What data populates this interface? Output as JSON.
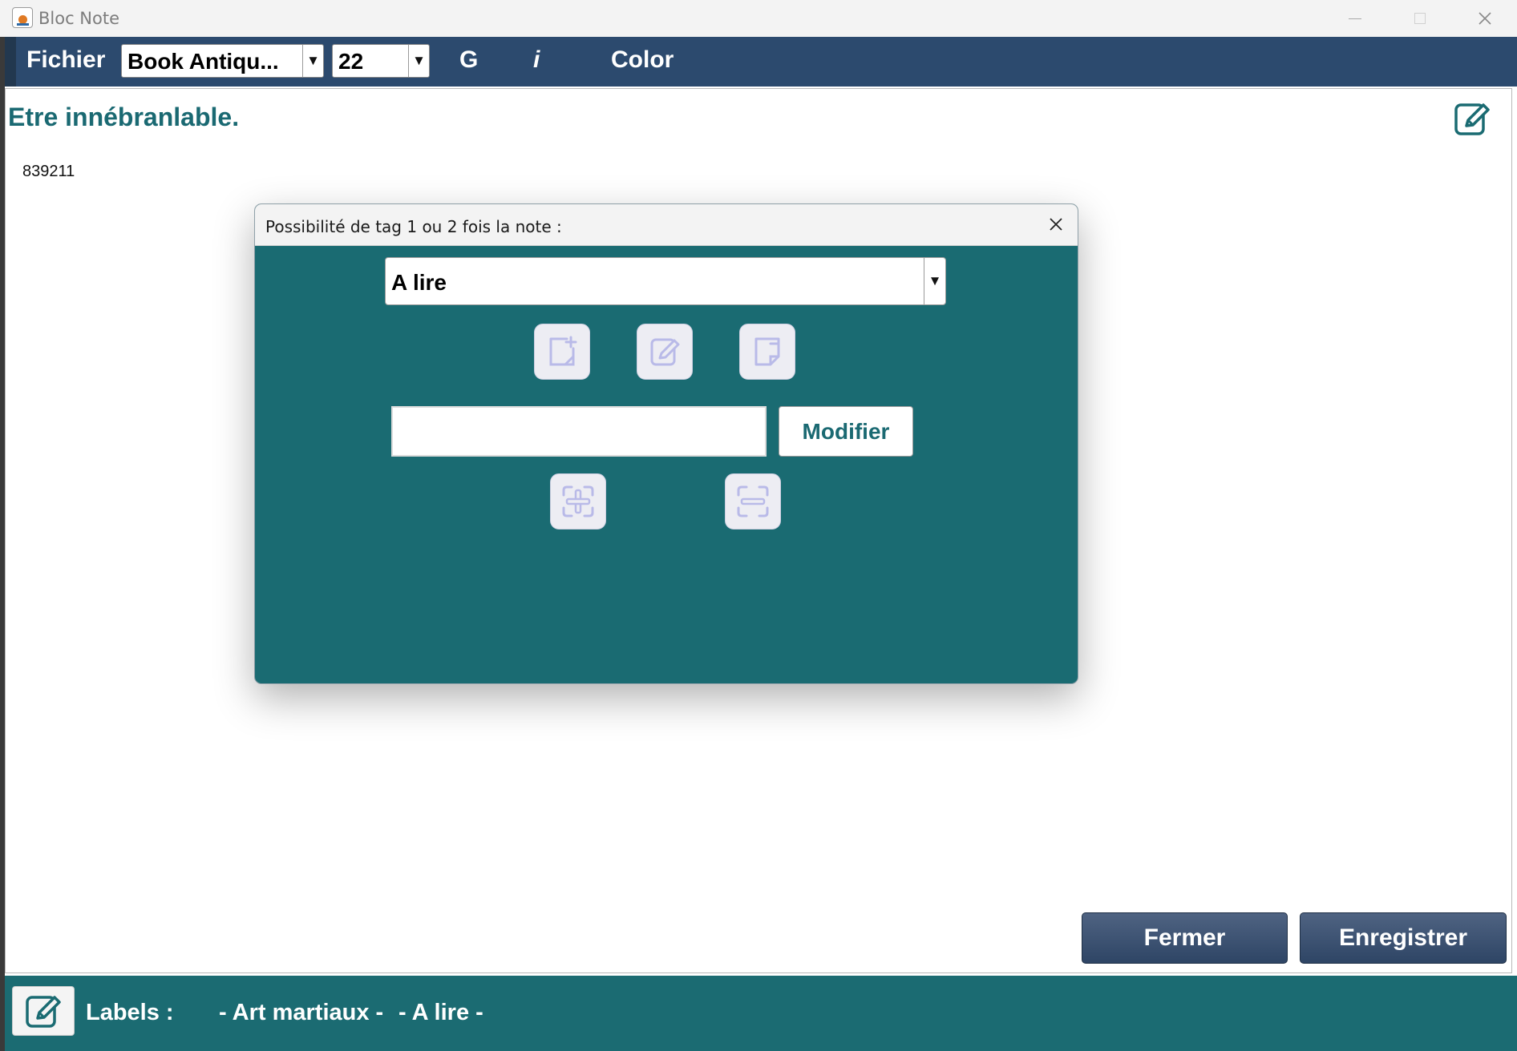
{
  "window": {
    "title": "Bloc Note"
  },
  "toolbar": {
    "file_menu": "Fichier",
    "font_family": "Book Antiqu...",
    "font_size": "22",
    "bold": "G",
    "italic": "i",
    "color": "Color",
    "dropdown_arrow": "▼"
  },
  "note": {
    "title": "Etre innébranlable.",
    "number": "839211"
  },
  "actions": {
    "close": "Fermer",
    "save": "Enregistrer"
  },
  "footer": {
    "labels_heading": "Labels :",
    "labels": [
      "- Art martiaux -",
      "- A lire -"
    ]
  },
  "dialog": {
    "title": "Possibilité de tag 1 ou 2 fois la note :",
    "selected_tag": "A lire",
    "input_value": "",
    "modify_button": "Modifier",
    "icon_buttons": [
      "new-note-icon",
      "edit-note-icon",
      "delete-note-icon",
      "plus-icon",
      "minus-icon"
    ]
  },
  "colors": {
    "toolbar": "#2c4a6e",
    "teal": "#1a6b72",
    "title_text": "#1a6972",
    "icon_tint": "#b9bae8"
  }
}
